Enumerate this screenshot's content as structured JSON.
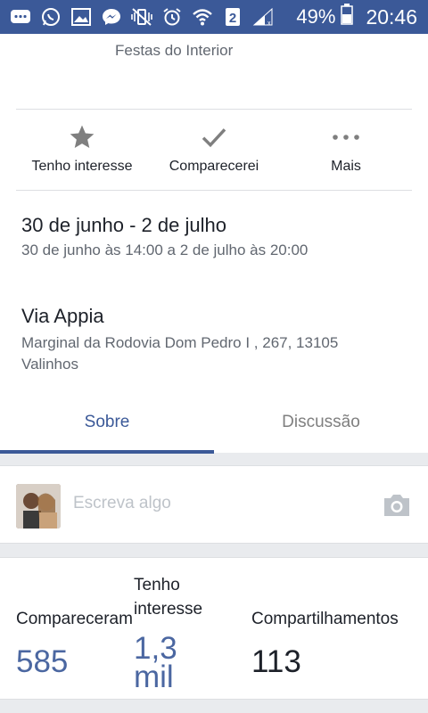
{
  "status_bar": {
    "battery_percent": "49%",
    "time": "20:46",
    "sim_badge": "2"
  },
  "event": {
    "category": "Festas do Interior",
    "actions": [
      {
        "label": "Tenho interesse",
        "icon": "star-icon"
      },
      {
        "label": "Comparecerei",
        "icon": "check-icon"
      },
      {
        "label": "Mais",
        "icon": "more-icon"
      }
    ],
    "date": {
      "title": "30 de junho - 2 de julho",
      "detail": "30 de junho às 14:00 a 2 de julho às 20:00"
    },
    "place": {
      "name": "Via Appia",
      "address": "Marginal da Rodovia Dom Pedro I , 267, 13105 Valinhos"
    },
    "tabs": [
      {
        "label": "Sobre",
        "active": true
      },
      {
        "label": "Discussão",
        "active": false
      }
    ]
  },
  "composer": {
    "placeholder": "Escreva algo"
  },
  "stats": {
    "attended": {
      "label": "Compareceram",
      "value": "585"
    },
    "interested": {
      "label": "Tenho interesse",
      "value": "1,3 mil"
    },
    "shares": {
      "label": "Compartilhamentos",
      "value": "113"
    }
  },
  "colors": {
    "brand": "#3b5998",
    "stat_blue": "#4b67a1",
    "muted": "#616770"
  }
}
